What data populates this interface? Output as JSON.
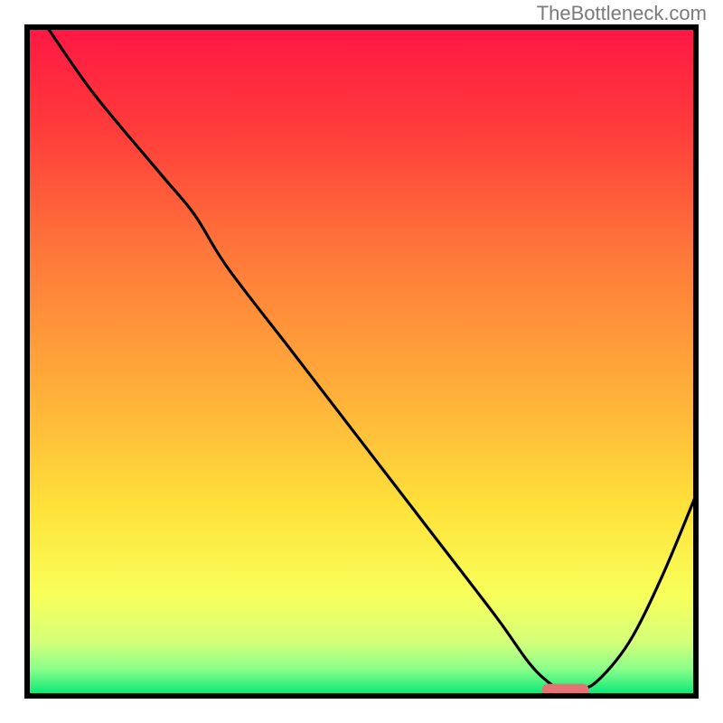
{
  "watermark": "TheBottleneck.com",
  "chart_data": {
    "type": "line",
    "title": "",
    "xlabel": "",
    "ylabel": "",
    "xlim": [
      0,
      100
    ],
    "ylim": [
      0,
      100
    ],
    "x": [
      3,
      10,
      20,
      25,
      30,
      40,
      50,
      60,
      70,
      75,
      78,
      80,
      82,
      85,
      90,
      95,
      100
    ],
    "values": [
      100,
      90,
      78,
      72,
      64,
      51,
      38,
      25,
      12,
      5,
      2,
      1,
      1,
      2,
      8,
      18,
      30
    ],
    "optimum_marker": {
      "x_start": 77,
      "x_end": 84,
      "y": 1
    },
    "background_gradient": {
      "stops": [
        {
          "offset": 0.0,
          "color": "#ff1744"
        },
        {
          "offset": 0.15,
          "color": "#ff3b3b"
        },
        {
          "offset": 0.35,
          "color": "#ff7b3a"
        },
        {
          "offset": 0.55,
          "color": "#ffb03a"
        },
        {
          "offset": 0.72,
          "color": "#ffe23a"
        },
        {
          "offset": 0.85,
          "color": "#f8ff5a"
        },
        {
          "offset": 0.92,
          "color": "#d4ff7a"
        },
        {
          "offset": 0.96,
          "color": "#8aff8a"
        },
        {
          "offset": 1.0,
          "color": "#00e676"
        }
      ]
    }
  }
}
